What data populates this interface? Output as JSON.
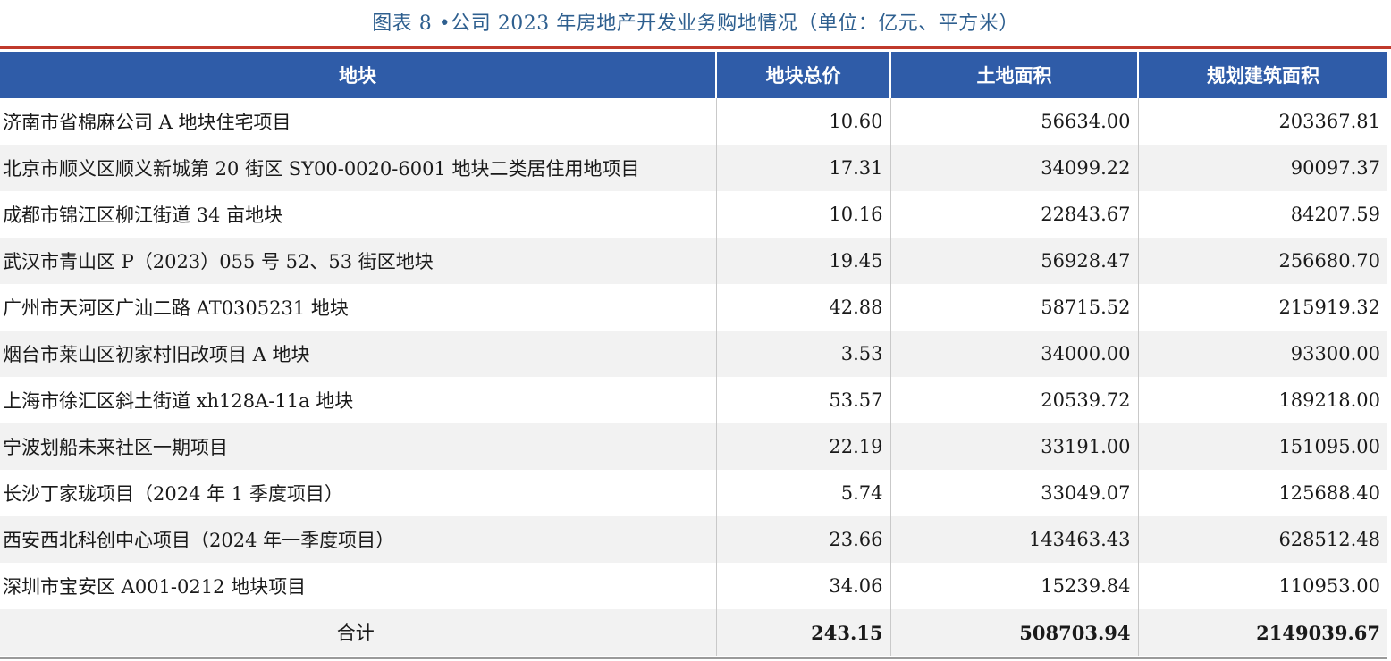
{
  "caption": "图表 8 •公司 2023 年房地产开发业务购地情况（单位：亿元、平方米）",
  "chart_data": {
    "type": "table",
    "title": "图表 8 •公司 2023 年房地产开发业务购地情况（单位：亿元、平方米）",
    "columns": [
      "地块",
      "地块总价",
      "土地面积",
      "规划建筑面积"
    ],
    "rows": [
      [
        "济南市省棉麻公司 A 地块住宅项目",
        "10.60",
        "56634.00",
        "203367.81"
      ],
      [
        "北京市顺义区顺义新城第 20 街区 SY00-0020-6001 地块二类居住用地项目",
        "17.31",
        "34099.22",
        "90097.37"
      ],
      [
        "成都市锦江区柳江街道 34 亩地块",
        "10.16",
        "22843.67",
        "84207.59"
      ],
      [
        "武汉市青山区 P（2023）055 号 52、53 街区地块",
        "19.45",
        "56928.47",
        "256680.70"
      ],
      [
        "广州市天河区广汕二路 AT0305231 地块",
        "42.88",
        "58715.52",
        "215919.32"
      ],
      [
        "烟台市莱山区初家村旧改项目 A 地块",
        "3.53",
        "34000.00",
        "93300.00"
      ],
      [
        "上海市徐汇区斜土街道 xh128A-11a 地块",
        "53.57",
        "20539.72",
        "189218.00"
      ],
      [
        "宁波划船未来社区一期项目",
        "22.19",
        "33191.00",
        "151095.00"
      ],
      [
        "长沙丁家珑项目（2024 年 1 季度项目）",
        "5.74",
        "33049.07",
        "125688.40"
      ],
      [
        "西安西北科创中心项目（2024 年一季度项目）",
        "23.66",
        "143463.43",
        "628512.48"
      ],
      [
        "深圳市宝安区 A001-0212 地块项目",
        "34.06",
        "15239.84",
        "110953.00"
      ]
    ],
    "total": [
      "合计",
      "243.15",
      "508703.94",
      "2149039.67"
    ]
  }
}
